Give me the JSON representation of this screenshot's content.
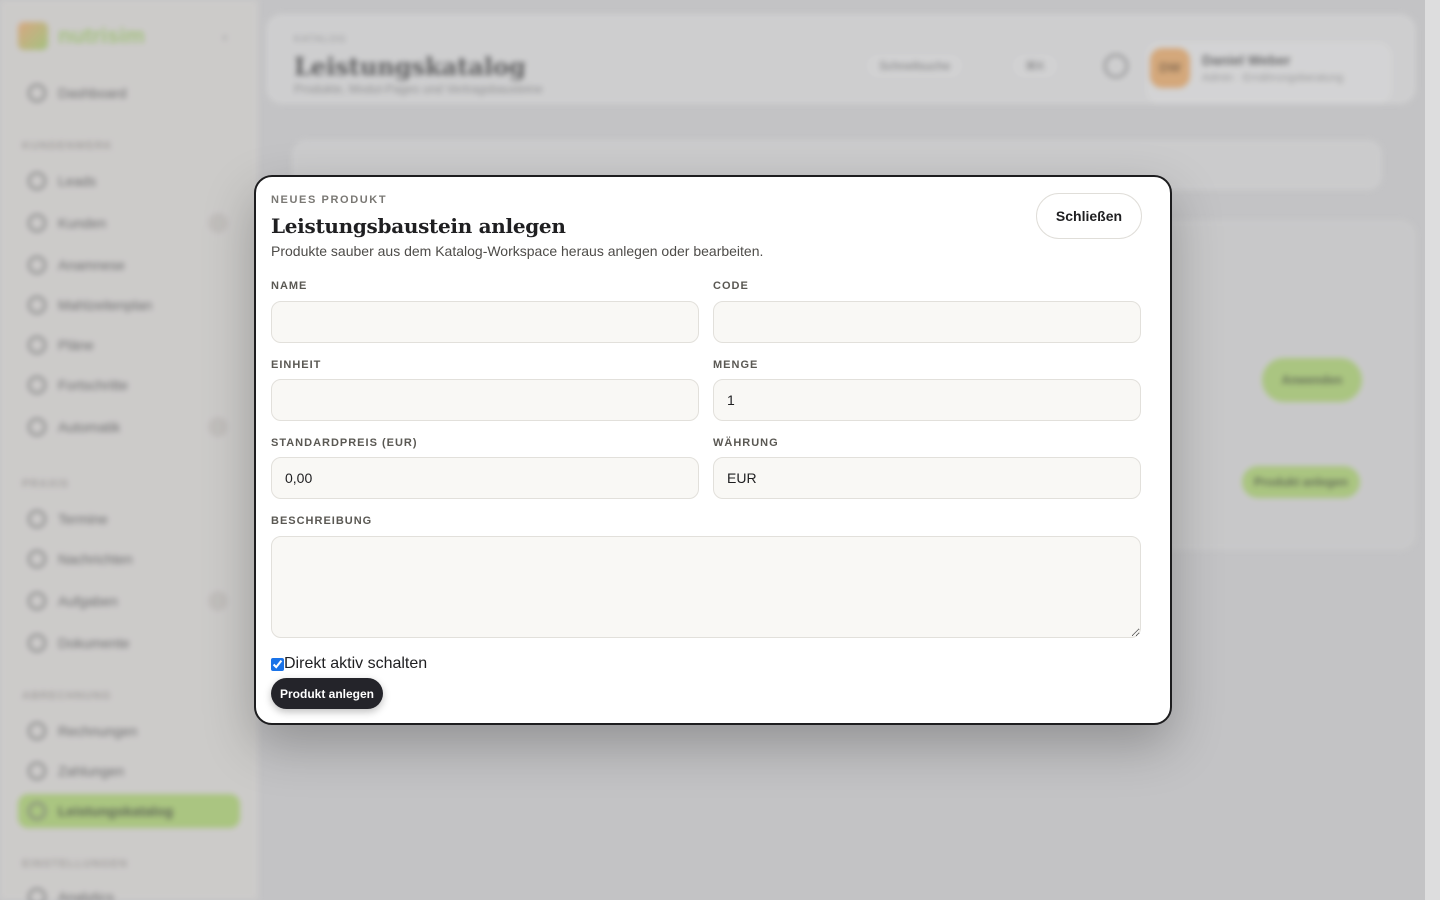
{
  "modal": {
    "eyebrow": "NEUES PRODUKT",
    "title": "Leistungsbaustein anlegen",
    "subtitle": "Produkte sauber aus dem Katalog-Workspace heraus anlegen oder bearbeiten.",
    "close_label": "Schließen",
    "fields": {
      "name": {
        "label": "NAME",
        "value": ""
      },
      "code": {
        "label": "CODE",
        "value": ""
      },
      "einheit": {
        "label": "EINHEIT",
        "value": ""
      },
      "menge": {
        "label": "MENGE",
        "value": "1"
      },
      "standardpreis": {
        "label": "STANDARDPREIS (EUR)",
        "value": "0,00"
      },
      "waehrung": {
        "label": "WÄHRUNG",
        "value": "EUR"
      },
      "beschreibung": {
        "label": "BESCHREIBUNG",
        "value": ""
      }
    },
    "active_checkbox": {
      "label": "Direkt aktiv schalten",
      "checked": true
    },
    "submit_label": "Produkt anlegen"
  },
  "background": {
    "logo_text": "nutrisim",
    "page_crumb": "KATALOG",
    "page_title": "Leistungskatalog",
    "page_subtitle": "Produkte, Modul-Pages und Vertragsbausteine",
    "search_label": "Schnellsuche",
    "shortcut_label": "⌘K",
    "user_initials": "DW",
    "user_name": "Daniel Weber",
    "user_role": "Admin · Ernährungsberatung",
    "sections": [
      "KUNDENWERK",
      "PRAXIS",
      "ABRECHNUNG",
      "EINSTELLUNGEN"
    ],
    "nav": [
      "Dashboard",
      "Leads",
      "Kunden",
      "Anamnese",
      "Mahlzeitenplan",
      "Pläne",
      "Fortschritte",
      "Automatik",
      "Termine",
      "Nachrichten",
      "Aufgaben",
      "Dokumente",
      "Rechnungen",
      "Leistungskatalog",
      "Zahlungen",
      "Analytics"
    ],
    "active_nav": "Leistungskatalog",
    "green_button_1": "Anwenden",
    "green_button_2": "Produkt anlegen"
  },
  "colors": {
    "accent_green": "#a6d65a",
    "dark_button": "#24242a",
    "modal_border": "#1d1d1f",
    "input_bg": "#f9f8f5"
  }
}
